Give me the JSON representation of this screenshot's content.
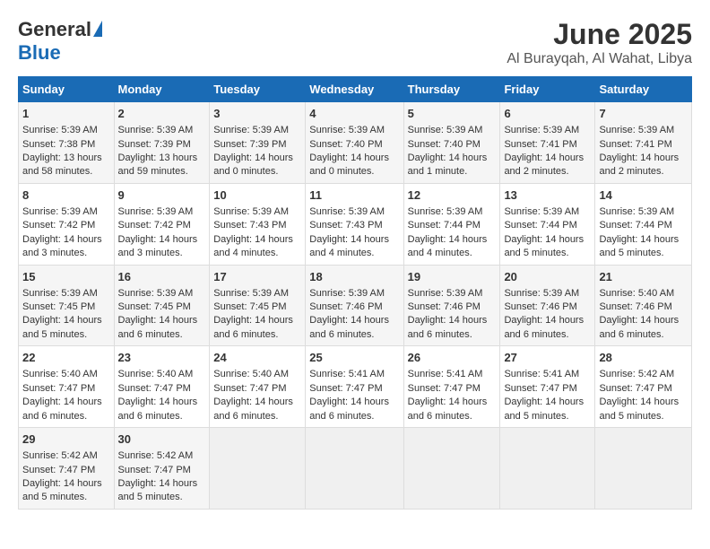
{
  "header": {
    "logo_general": "General",
    "logo_blue": "Blue",
    "title": "June 2025",
    "location": "Al Burayqah, Al Wahat, Libya"
  },
  "calendar": {
    "days_of_week": [
      "Sunday",
      "Monday",
      "Tuesday",
      "Wednesday",
      "Thursday",
      "Friday",
      "Saturday"
    ],
    "weeks": [
      [
        {
          "day": "",
          "empty": true
        },
        {
          "day": "",
          "empty": true
        },
        {
          "day": "",
          "empty": true
        },
        {
          "day": "",
          "empty": true
        },
        {
          "day": "",
          "empty": true
        },
        {
          "day": "",
          "empty": true
        },
        {
          "day": "1",
          "sunrise": "Sunrise: 5:39 AM",
          "sunset": "Sunset: 7:38 PM",
          "daylight": "Daylight: 13 hours and 58 minutes."
        }
      ],
      [
        {
          "day": "2",
          "sunrise": "Sunrise: 5:39 AM",
          "sunset": "Sunset: 7:39 PM",
          "daylight": "Daylight: 13 hours and 59 minutes."
        },
        {
          "day": "3",
          "sunrise": "Sunrise: 5:39 AM",
          "sunset": "Sunset: 7:39 PM",
          "daylight": "Daylight: 14 hours and 0 minutes."
        },
        {
          "day": "4",
          "sunrise": "Sunrise: 5:39 AM",
          "sunset": "Sunset: 7:40 PM",
          "daylight": "Daylight: 14 hours and 0 minutes."
        },
        {
          "day": "5",
          "sunrise": "Sunrise: 5:39 AM",
          "sunset": "Sunset: 7:40 PM",
          "daylight": "Daylight: 14 hours and 1 minute."
        },
        {
          "day": "6",
          "sunrise": "Sunrise: 5:39 AM",
          "sunset": "Sunset: 7:41 PM",
          "daylight": "Daylight: 14 hours and 2 minutes."
        },
        {
          "day": "7",
          "sunrise": "Sunrise: 5:39 AM",
          "sunset": "Sunset: 7:41 PM",
          "daylight": "Daylight: 14 hours and 2 minutes."
        }
      ],
      [
        {
          "day": "8",
          "sunrise": "Sunrise: 5:39 AM",
          "sunset": "Sunset: 7:42 PM",
          "daylight": "Daylight: 14 hours and 3 minutes."
        },
        {
          "day": "9",
          "sunrise": "Sunrise: 5:39 AM",
          "sunset": "Sunset: 7:42 PM",
          "daylight": "Daylight: 14 hours and 3 minutes."
        },
        {
          "day": "10",
          "sunrise": "Sunrise: 5:39 AM",
          "sunset": "Sunset: 7:43 PM",
          "daylight": "Daylight: 14 hours and 4 minutes."
        },
        {
          "day": "11",
          "sunrise": "Sunrise: 5:39 AM",
          "sunset": "Sunset: 7:43 PM",
          "daylight": "Daylight: 14 hours and 4 minutes."
        },
        {
          "day": "12",
          "sunrise": "Sunrise: 5:39 AM",
          "sunset": "Sunset: 7:44 PM",
          "daylight": "Daylight: 14 hours and 4 minutes."
        },
        {
          "day": "13",
          "sunrise": "Sunrise: 5:39 AM",
          "sunset": "Sunset: 7:44 PM",
          "daylight": "Daylight: 14 hours and 5 minutes."
        },
        {
          "day": "14",
          "sunrise": "Sunrise: 5:39 AM",
          "sunset": "Sunset: 7:44 PM",
          "daylight": "Daylight: 14 hours and 5 minutes."
        }
      ],
      [
        {
          "day": "15",
          "sunrise": "Sunrise: 5:39 AM",
          "sunset": "Sunset: 7:45 PM",
          "daylight": "Daylight: 14 hours and 5 minutes."
        },
        {
          "day": "16",
          "sunrise": "Sunrise: 5:39 AM",
          "sunset": "Sunset: 7:45 PM",
          "daylight": "Daylight: 14 hours and 6 minutes."
        },
        {
          "day": "17",
          "sunrise": "Sunrise: 5:39 AM",
          "sunset": "Sunset: 7:45 PM",
          "daylight": "Daylight: 14 hours and 6 minutes."
        },
        {
          "day": "18",
          "sunrise": "Sunrise: 5:39 AM",
          "sunset": "Sunset: 7:46 PM",
          "daylight": "Daylight: 14 hours and 6 minutes."
        },
        {
          "day": "19",
          "sunrise": "Sunrise: 5:39 AM",
          "sunset": "Sunset: 7:46 PM",
          "daylight": "Daylight: 14 hours and 6 minutes."
        },
        {
          "day": "20",
          "sunrise": "Sunrise: 5:39 AM",
          "sunset": "Sunset: 7:46 PM",
          "daylight": "Daylight: 14 hours and 6 minutes."
        },
        {
          "day": "21",
          "sunrise": "Sunrise: 5:40 AM",
          "sunset": "Sunset: 7:46 PM",
          "daylight": "Daylight: 14 hours and 6 minutes."
        }
      ],
      [
        {
          "day": "22",
          "sunrise": "Sunrise: 5:40 AM",
          "sunset": "Sunset: 7:47 PM",
          "daylight": "Daylight: 14 hours and 6 minutes."
        },
        {
          "day": "23",
          "sunrise": "Sunrise: 5:40 AM",
          "sunset": "Sunset: 7:47 PM",
          "daylight": "Daylight: 14 hours and 6 minutes."
        },
        {
          "day": "24",
          "sunrise": "Sunrise: 5:40 AM",
          "sunset": "Sunset: 7:47 PM",
          "daylight": "Daylight: 14 hours and 6 minutes."
        },
        {
          "day": "25",
          "sunrise": "Sunrise: 5:41 AM",
          "sunset": "Sunset: 7:47 PM",
          "daylight": "Daylight: 14 hours and 6 minutes."
        },
        {
          "day": "26",
          "sunrise": "Sunrise: 5:41 AM",
          "sunset": "Sunset: 7:47 PM",
          "daylight": "Daylight: 14 hours and 6 minutes."
        },
        {
          "day": "27",
          "sunrise": "Sunrise: 5:41 AM",
          "sunset": "Sunset: 7:47 PM",
          "daylight": "Daylight: 14 hours and 5 minutes."
        },
        {
          "day": "28",
          "sunrise": "Sunrise: 5:42 AM",
          "sunset": "Sunset: 7:47 PM",
          "daylight": "Daylight: 14 hours and 5 minutes."
        }
      ],
      [
        {
          "day": "29",
          "sunrise": "Sunrise: 5:42 AM",
          "sunset": "Sunset: 7:47 PM",
          "daylight": "Daylight: 14 hours and 5 minutes."
        },
        {
          "day": "30",
          "sunrise": "Sunrise: 5:42 AM",
          "sunset": "Sunset: 7:47 PM",
          "daylight": "Daylight: 14 hours and 5 minutes."
        },
        {
          "day": "",
          "empty": true
        },
        {
          "day": "",
          "empty": true
        },
        {
          "day": "",
          "empty": true
        },
        {
          "day": "",
          "empty": true
        },
        {
          "day": "",
          "empty": true
        }
      ]
    ]
  }
}
